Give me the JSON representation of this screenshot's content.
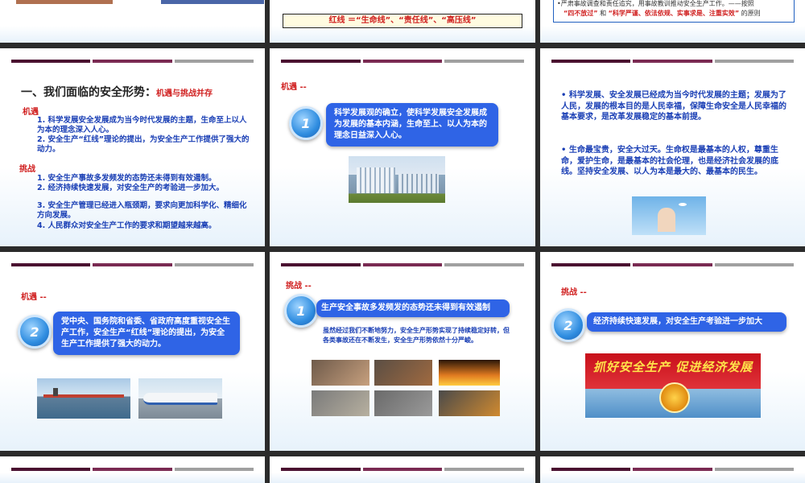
{
  "top_row": {
    "banner_text": "红线 ＝“生命线”、“责任线”、“高压线”",
    "note_line1": "•严肃事故调查和责任追究，用事故教训推动安全生产工作。——按照",
    "note_line2_a": "“四不放过”",
    "note_line2_b": "和",
    "note_line2_c": "“科学严谨、依法依规、实事求是、注重实效”",
    "note_line2_d": "的原则"
  },
  "slide_situation": {
    "title": "一、我们面临的安全形势",
    "colon": "：",
    "subtitle": "机遇与挑战并存",
    "opp_heading": "机遇",
    "opp_items": [
      "1.    科学发展安全发展成为当今时代发展的主题，生命至上以人为本的理念深入人心。",
      "2.    安全生产“红线”理论的提出，为安全生产工作提供了强大的动力。"
    ],
    "chal_heading": "挑战",
    "chal_items": [
      "1.    安全生产事故多发频发的态势还未得到有效遏制。",
      "2.    经济持续快速发展，对安全生产的考验进一步加大。",
      "3.    安全生产管理已经进入瓶颈期，要求向更加科学化、精细化方向发展。",
      "4.    人民群众对安全生产工作的要求和期望越来越高。"
    ]
  },
  "slide_opp1": {
    "label": "机遇 --",
    "number": "1",
    "text": "科学发展观的确立，使科学发展安全发展成为发展的基本内涵，生命至上、以人为本的理念日益深入人心。"
  },
  "slide_points": {
    "para1": "•   科学发展、安全发展已经成为当今时代发展的主题；发展为了人民，发展的根本目的是人民幸福，保障生命安全是人民幸福的基本要求，是改革发展稳定的基本前提。",
    "para2": "•   生命最宝贵，安全大过天。生命权是最基本的人权，尊重生命，爱护生命，是最基本的社会伦理，也是经济社会发展的底线。坚持安全发展、以人为本是最大的、最基本的民生。"
  },
  "slide_opp2": {
    "label": "机遇 --",
    "number": "2",
    "text": "党中央、国务院和省委、省政府高度重视安全生产工作，安全生产“红线”理论的提出，为安全生产工作提供了强大的动力。"
  },
  "slide_chal1": {
    "label": "挑战 --",
    "number": "1",
    "box_text": "生产安全事故多发频发的态势还未得到有效遏制",
    "desc": "虽然经过我们不断地努力，安全生产形势实现了持续稳定好转，但各类事故还在不断发生，安全生产形势依然十分严峻。"
  },
  "slide_chal2": {
    "label": "挑战 --",
    "number": "2",
    "box_text": "经济持续快速发展，对安全生产考验进一步加大",
    "banner_text": "抓好安全生产 促进经济发展"
  },
  "colors": {
    "blue_text": "#1a3fb5",
    "red_text": "#d02020",
    "box_blue": "#2f64e6",
    "bar_dark": "#4a1030",
    "bar_mid": "#7a2a52",
    "bar_gray": "#a0a0a0"
  }
}
